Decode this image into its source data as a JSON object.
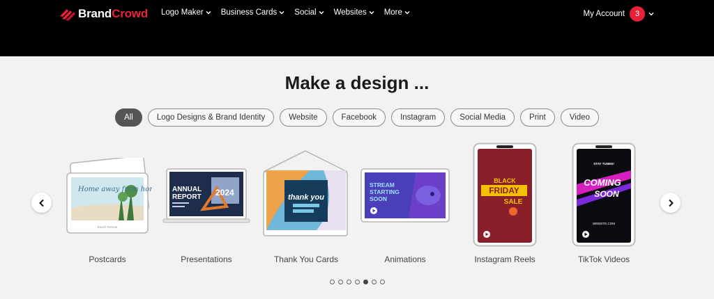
{
  "header": {
    "brand_part1": "Brand",
    "brand_part2": "Crowd",
    "nav": [
      {
        "label": "Logo Maker"
      },
      {
        "label": "Business Cards"
      },
      {
        "label": "Social"
      },
      {
        "label": "Websites"
      },
      {
        "label": "More"
      }
    ],
    "account_label": "My Account",
    "notification_count": "3"
  },
  "heading": "Make a design ...",
  "filters": [
    "All",
    "Logo Designs & Brand Identity",
    "Website",
    "Facebook",
    "Instagram",
    "Social Media",
    "Print",
    "Video"
  ],
  "active_filter": "All",
  "carousel": {
    "items": [
      {
        "label": "Postcards",
        "thumb_text": "Home away from home",
        "thumb_footer": "Beach Retreat"
      },
      {
        "label": "Presentations",
        "thumb_text_1": "ANNUAL",
        "thumb_text_2": "REPORT",
        "thumb_year": "2024"
      },
      {
        "label": "Thank You Cards",
        "thumb_text": "thank you"
      },
      {
        "label": "Animations",
        "thumb_text_1": "STREAM",
        "thumb_text_2": "STARTING",
        "thumb_text_3": "SOON"
      },
      {
        "label": "Instagram Reels",
        "thumb_text_1": "BLACK",
        "thumb_text_2": "FRIDAY",
        "thumb_text_3": "SALE"
      },
      {
        "label": "TikTok Videos",
        "thumb_text_1": "COMING",
        "thumb_text_2": "SOON",
        "thumb_top": "STAY TUNED!",
        "thumb_bottom": "WEBSITE.COM"
      }
    ],
    "page_count": 7,
    "active_page": 5
  },
  "colors": {
    "brand_red": "#e8213a",
    "header_bg": "#000000",
    "page_bg": "#f2f2f2"
  }
}
